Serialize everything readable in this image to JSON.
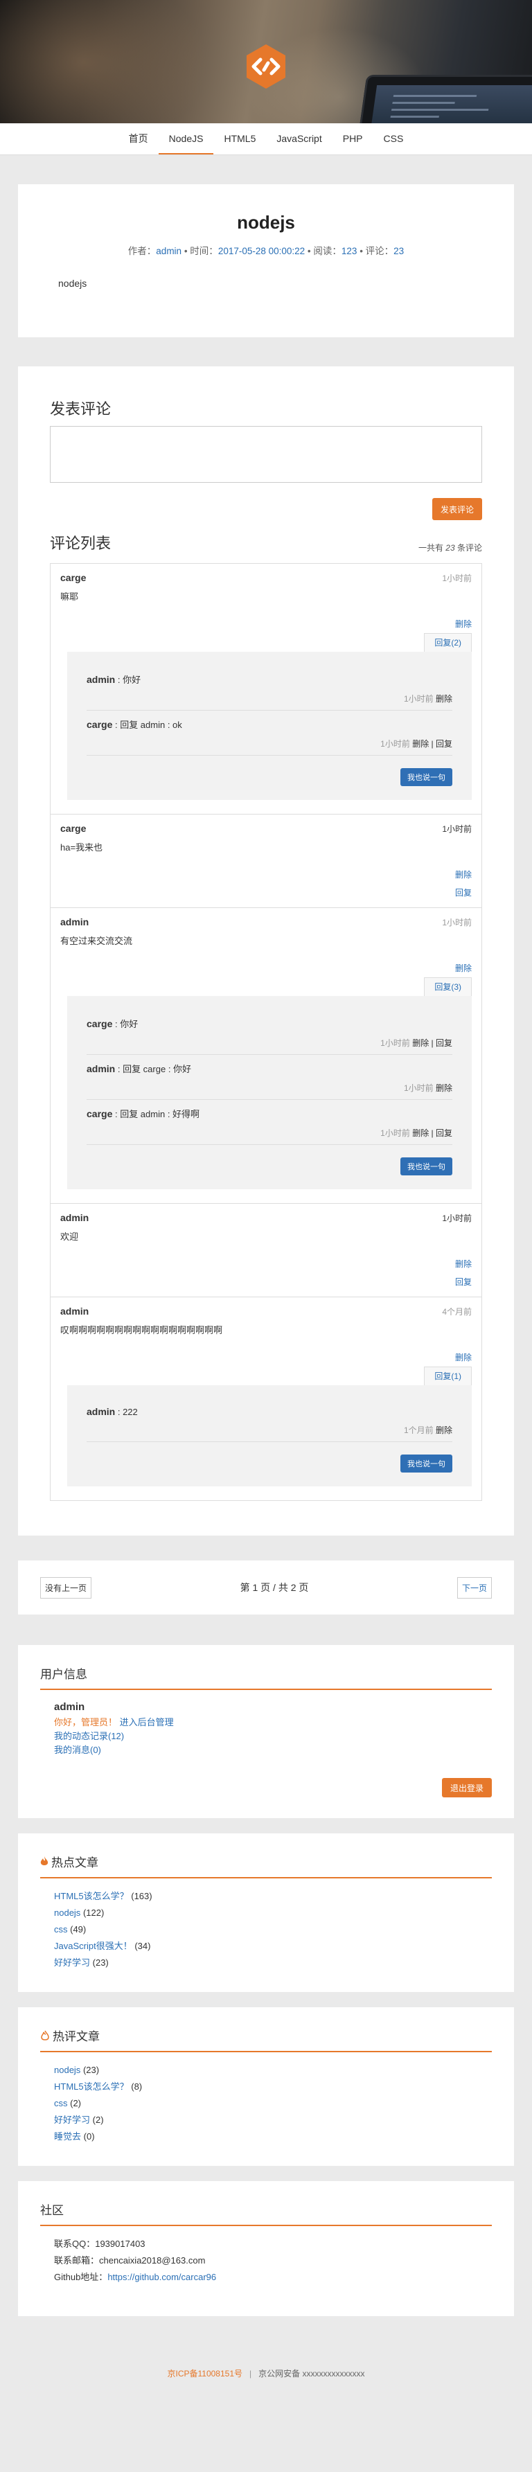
{
  "nav": {
    "items": [
      "首页",
      "NodeJS",
      "HTML5",
      "JavaScript",
      "PHP",
      "CSS"
    ]
  },
  "article": {
    "title": "nodejs",
    "meta": {
      "author_label": "作者：",
      "author": "admin",
      "time_label": " • 时间：",
      "time": "2017-05-28 00:00:22",
      "read_label": " • 阅读：",
      "reads": "123",
      "comment_label": " • 评论：",
      "comments": "23"
    },
    "body": "nodejs"
  },
  "comment_form": {
    "title": "发表评论",
    "submit": "发表评论"
  },
  "comment_list": {
    "title": "评论列表",
    "total_prefix": "一共有 ",
    "total_count": "23",
    "total_suffix": " 条评论",
    "items": [
      {
        "name": "carge",
        "time": "1小时前",
        "text": "嘛耶",
        "actions": [
          "删除"
        ],
        "reply_btn": "回复(2)",
        "replies": [
          {
            "name": "admin",
            "text": " : 你好",
            "time": "1小时前",
            "ops": "删除"
          },
          {
            "name": "carge",
            "text": " : 回复 admin : ok",
            "time": "1小时前",
            "ops": "删除 | 回复"
          }
        ],
        "reply_submit": "我也说一句"
      },
      {
        "name": "carge",
        "time": "1小时前",
        "text": "ha=我来也",
        "actions": [
          "删除",
          "回复"
        ]
      },
      {
        "name": "admin",
        "time": "1小时前",
        "text": "有空过来交流交流",
        "actions": [
          "删除"
        ],
        "reply_btn": "回复(3)",
        "replies": [
          {
            "name": "carge",
            "text": " : 你好",
            "time": "1小时前",
            "ops": "删除 | 回复"
          },
          {
            "name": "admin",
            "text": " : 回复 carge : 你好",
            "time": "1小时前",
            "ops": "删除"
          },
          {
            "name": "carge",
            "text": " : 回复 admin : 好得啊",
            "time": "1小时前",
            "ops": "删除 | 回复"
          }
        ],
        "reply_submit": "我也说一句"
      },
      {
        "name": "admin",
        "time": "1小时前",
        "text": "欢迎",
        "actions": [
          "删除",
          "回复"
        ]
      },
      {
        "name": "admin",
        "time": "4个月前",
        "text": "叹啊啊啊啊啊啊啊啊啊啊啊啊啊啊啊啊啊",
        "actions": [
          "删除"
        ],
        "reply_btn": "回复(1)",
        "replies": [
          {
            "name": "admin",
            "text": " : 222",
            "time": "1个月前",
            "ops": "删除"
          }
        ],
        "reply_submit": "我也说一句"
      }
    ]
  },
  "pager": {
    "prev": "没有上一页",
    "info": "第 1 页 / 共 2 页",
    "next": "下一页"
  },
  "user_info": {
    "title": "用户信息",
    "name": "admin",
    "greeting": "你好，管理员！",
    "admin_link": "进入后台管理",
    "links": [
      "我的动态记录(12)",
      "我的消息(0)"
    ],
    "logout": "退出登录"
  },
  "hot_articles": {
    "title": "热点文章",
    "items": [
      {
        "name": "HTML5该怎么学？",
        "count": "(163)"
      },
      {
        "name": "nodejs",
        "count": "(122)"
      },
      {
        "name": "css",
        "count": "(49)"
      },
      {
        "name": "JavaScript很强大！",
        "count": "(34)"
      },
      {
        "name": "好好学习",
        "count": "(23)"
      }
    ]
  },
  "hot_comments": {
    "title": "热评文章",
    "items": [
      {
        "name": "nodejs",
        "count": "(23)"
      },
      {
        "name": "HTML5该怎么学？",
        "count": "(8)"
      },
      {
        "name": "css",
        "count": "(2)"
      },
      {
        "name": "好好学习",
        "count": "(2)"
      },
      {
        "name": "睡觉去",
        "count": "(0)"
      }
    ]
  },
  "community": {
    "title": "社区",
    "qq": "联系QQ：1939017403",
    "email": "联系邮箱：chencaixia2018@163.com",
    "github_label": "Github地址：",
    "github_url": "https://github.com/carcar96"
  },
  "footer": {
    "icp": "京ICP备11008151号",
    "sep": "|",
    "police": "京公网安备 xxxxxxxxxxxxxxx"
  },
  "colors": {
    "accent": "#e6782b",
    "link": "#2a6fb5",
    "button_blue": "#2f6fb5"
  }
}
